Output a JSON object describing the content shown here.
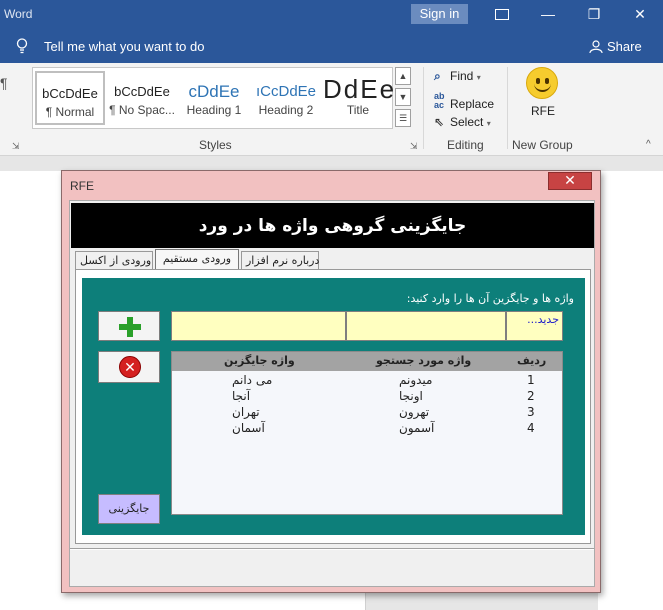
{
  "window": {
    "app_title": "Word",
    "sign_in": "Sign in",
    "minimize_glyph": "—",
    "maximize_glyph": "❐",
    "close_glyph": "✕"
  },
  "tellbar": {
    "tell_me": "Tell me what you want to do",
    "share": "Share"
  },
  "ribbon": {
    "paragraph_mark": "¶",
    "styles": [
      {
        "sample": "bCcDdEe",
        "name": "¶ Normal"
      },
      {
        "sample": "bCcDdEe",
        "name": "¶ No Spac..."
      },
      {
        "sample": "cDdEe",
        "name": "Heading 1"
      },
      {
        "sample": "ıCcDdEe",
        "name": "Heading 2"
      },
      {
        "sample": "DdEe",
        "name": "Title"
      }
    ],
    "styles_group_label": "Styles",
    "editing": {
      "find": "Find",
      "replace": "Replace",
      "select": "Select"
    },
    "editing_group_label": "Editing",
    "rfe_label": "RFE",
    "new_group_label": "New Group",
    "collapse_glyph": "^"
  },
  "dialog": {
    "title": "RFE",
    "close_glyph": "✕",
    "banner": "جایگزینی گروهی واژه ها در ورد",
    "tabs": [
      "ورودی از اکسل",
      "ورودی مستقیم",
      "درباره نرم افزار"
    ],
    "instruction": "واژه ها و جایگزین آن ها را وارد کنید:",
    "new_hint": "جدید...",
    "columns": {
      "index": "ردیف",
      "search": "واژه مورد جستجو",
      "replace": "واژه جایگزین"
    },
    "rows": [
      {
        "index": "1",
        "search": "میدونم",
        "replace": "می دانم"
      },
      {
        "index": "2",
        "search": "اونجا",
        "replace": "آنجا"
      },
      {
        "index": "3",
        "search": "تهرون",
        "replace": "تهران"
      },
      {
        "index": "4",
        "search": "آسمون",
        "replace": "آسمان"
      }
    ],
    "replace_button": "جایگزینی"
  },
  "colors": {
    "word_blue": "#2b579a",
    "dialog_pink": "#f2c1c1",
    "teal_panel": "#0d7f7a",
    "input_yellow": "#ffffc0",
    "replace_button": "#c6bcff"
  }
}
